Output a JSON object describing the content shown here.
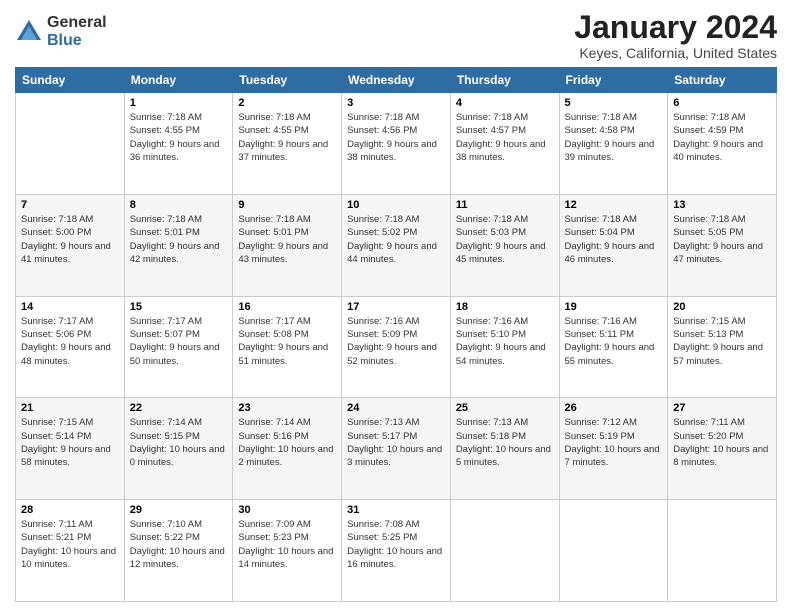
{
  "logo": {
    "general": "General",
    "blue": "Blue"
  },
  "title": "January 2024",
  "subtitle": "Keyes, California, United States",
  "days_of_week": [
    "Sunday",
    "Monday",
    "Tuesday",
    "Wednesday",
    "Thursday",
    "Friday",
    "Saturday"
  ],
  "weeks": [
    [
      {
        "num": "",
        "sunrise": "",
        "sunset": "",
        "daylight": ""
      },
      {
        "num": "1",
        "sunrise": "Sunrise: 7:18 AM",
        "sunset": "Sunset: 4:55 PM",
        "daylight": "Daylight: 9 hours and 36 minutes."
      },
      {
        "num": "2",
        "sunrise": "Sunrise: 7:18 AM",
        "sunset": "Sunset: 4:55 PM",
        "daylight": "Daylight: 9 hours and 37 minutes."
      },
      {
        "num": "3",
        "sunrise": "Sunrise: 7:18 AM",
        "sunset": "Sunset: 4:56 PM",
        "daylight": "Daylight: 9 hours and 38 minutes."
      },
      {
        "num": "4",
        "sunrise": "Sunrise: 7:18 AM",
        "sunset": "Sunset: 4:57 PM",
        "daylight": "Daylight: 9 hours and 38 minutes."
      },
      {
        "num": "5",
        "sunrise": "Sunrise: 7:18 AM",
        "sunset": "Sunset: 4:58 PM",
        "daylight": "Daylight: 9 hours and 39 minutes."
      },
      {
        "num": "6",
        "sunrise": "Sunrise: 7:18 AM",
        "sunset": "Sunset: 4:59 PM",
        "daylight": "Daylight: 9 hours and 40 minutes."
      }
    ],
    [
      {
        "num": "7",
        "sunrise": "Sunrise: 7:18 AM",
        "sunset": "Sunset: 5:00 PM",
        "daylight": "Daylight: 9 hours and 41 minutes."
      },
      {
        "num": "8",
        "sunrise": "Sunrise: 7:18 AM",
        "sunset": "Sunset: 5:01 PM",
        "daylight": "Daylight: 9 hours and 42 minutes."
      },
      {
        "num": "9",
        "sunrise": "Sunrise: 7:18 AM",
        "sunset": "Sunset: 5:01 PM",
        "daylight": "Daylight: 9 hours and 43 minutes."
      },
      {
        "num": "10",
        "sunrise": "Sunrise: 7:18 AM",
        "sunset": "Sunset: 5:02 PM",
        "daylight": "Daylight: 9 hours and 44 minutes."
      },
      {
        "num": "11",
        "sunrise": "Sunrise: 7:18 AM",
        "sunset": "Sunset: 5:03 PM",
        "daylight": "Daylight: 9 hours and 45 minutes."
      },
      {
        "num": "12",
        "sunrise": "Sunrise: 7:18 AM",
        "sunset": "Sunset: 5:04 PM",
        "daylight": "Daylight: 9 hours and 46 minutes."
      },
      {
        "num": "13",
        "sunrise": "Sunrise: 7:18 AM",
        "sunset": "Sunset: 5:05 PM",
        "daylight": "Daylight: 9 hours and 47 minutes."
      }
    ],
    [
      {
        "num": "14",
        "sunrise": "Sunrise: 7:17 AM",
        "sunset": "Sunset: 5:06 PM",
        "daylight": "Daylight: 9 hours and 48 minutes."
      },
      {
        "num": "15",
        "sunrise": "Sunrise: 7:17 AM",
        "sunset": "Sunset: 5:07 PM",
        "daylight": "Daylight: 9 hours and 50 minutes."
      },
      {
        "num": "16",
        "sunrise": "Sunrise: 7:17 AM",
        "sunset": "Sunset: 5:08 PM",
        "daylight": "Daylight: 9 hours and 51 minutes."
      },
      {
        "num": "17",
        "sunrise": "Sunrise: 7:16 AM",
        "sunset": "Sunset: 5:09 PM",
        "daylight": "Daylight: 9 hours and 52 minutes."
      },
      {
        "num": "18",
        "sunrise": "Sunrise: 7:16 AM",
        "sunset": "Sunset: 5:10 PM",
        "daylight": "Daylight: 9 hours and 54 minutes."
      },
      {
        "num": "19",
        "sunrise": "Sunrise: 7:16 AM",
        "sunset": "Sunset: 5:11 PM",
        "daylight": "Daylight: 9 hours and 55 minutes."
      },
      {
        "num": "20",
        "sunrise": "Sunrise: 7:15 AM",
        "sunset": "Sunset: 5:13 PM",
        "daylight": "Daylight: 9 hours and 57 minutes."
      }
    ],
    [
      {
        "num": "21",
        "sunrise": "Sunrise: 7:15 AM",
        "sunset": "Sunset: 5:14 PM",
        "daylight": "Daylight: 9 hours and 58 minutes."
      },
      {
        "num": "22",
        "sunrise": "Sunrise: 7:14 AM",
        "sunset": "Sunset: 5:15 PM",
        "daylight": "Daylight: 10 hours and 0 minutes."
      },
      {
        "num": "23",
        "sunrise": "Sunrise: 7:14 AM",
        "sunset": "Sunset: 5:16 PM",
        "daylight": "Daylight: 10 hours and 2 minutes."
      },
      {
        "num": "24",
        "sunrise": "Sunrise: 7:13 AM",
        "sunset": "Sunset: 5:17 PM",
        "daylight": "Daylight: 10 hours and 3 minutes."
      },
      {
        "num": "25",
        "sunrise": "Sunrise: 7:13 AM",
        "sunset": "Sunset: 5:18 PM",
        "daylight": "Daylight: 10 hours and 5 minutes."
      },
      {
        "num": "26",
        "sunrise": "Sunrise: 7:12 AM",
        "sunset": "Sunset: 5:19 PM",
        "daylight": "Daylight: 10 hours and 7 minutes."
      },
      {
        "num": "27",
        "sunrise": "Sunrise: 7:11 AM",
        "sunset": "Sunset: 5:20 PM",
        "daylight": "Daylight: 10 hours and 8 minutes."
      }
    ],
    [
      {
        "num": "28",
        "sunrise": "Sunrise: 7:11 AM",
        "sunset": "Sunset: 5:21 PM",
        "daylight": "Daylight: 10 hours and 10 minutes."
      },
      {
        "num": "29",
        "sunrise": "Sunrise: 7:10 AM",
        "sunset": "Sunset: 5:22 PM",
        "daylight": "Daylight: 10 hours and 12 minutes."
      },
      {
        "num": "30",
        "sunrise": "Sunrise: 7:09 AM",
        "sunset": "Sunset: 5:23 PM",
        "daylight": "Daylight: 10 hours and 14 minutes."
      },
      {
        "num": "31",
        "sunrise": "Sunrise: 7:08 AM",
        "sunset": "Sunset: 5:25 PM",
        "daylight": "Daylight: 10 hours and 16 minutes."
      },
      {
        "num": "",
        "sunrise": "",
        "sunset": "",
        "daylight": ""
      },
      {
        "num": "",
        "sunrise": "",
        "sunset": "",
        "daylight": ""
      },
      {
        "num": "",
        "sunrise": "",
        "sunset": "",
        "daylight": ""
      }
    ]
  ]
}
